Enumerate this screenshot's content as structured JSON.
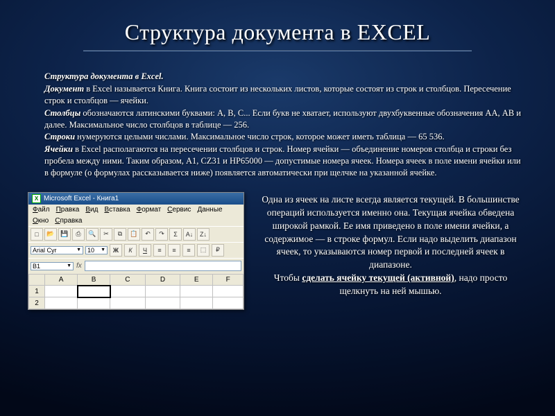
{
  "title": "Структура документа в EXCEL",
  "intro": {
    "heading": "Структура документа в Excel.",
    "p1a": "Документ",
    "p1b": " в Excel называется Книга. Книга состоит из нескольких листов, которые состоят из строк и столбцов. Пересечение строк и столбцов — ячейки.",
    "p2a": "Столбцы",
    "p2b": " обозначаются латинскими буквами: А, В, С... Если букв не хватает, используют двухбуквенные обозначения АА, АВ и далее. Максимальное число столбцов в таблице — 256.",
    "p3a": "Строки",
    "p3b": " нумеруются целыми числами. Максимальное число строк, которое может иметь таблица — 65 536.",
    "p4a": "Ячейки",
    "p4b": " в Excel располагаются на пересечении столбцов и строк. Номер ячейки — объединение номеров столбца и строки без пробела между ними. Таким образом, А1, CZ31 и НР65000 — допустимые номера ячеек. Номера ячеек в поле имени ячейки или в формуле (о формулах рассказывается ниже) появляется автоматически при щелчке на указанной ячейке."
  },
  "excel": {
    "title": "Microsoft Excel - Книга1",
    "menus": [
      "Файл",
      "Правка",
      "Вид",
      "Вставка",
      "Формат",
      "Сервис",
      "Данные",
      "Окно",
      "Справка"
    ],
    "font": "Arial Cyr",
    "fontsize": "10",
    "namebox": "B1",
    "cols": [
      "A",
      "B",
      "C",
      "D",
      "E",
      "F"
    ],
    "rows": [
      "1",
      "2"
    ]
  },
  "aside": {
    "p1": "Одна из ячеек на листе всегда является текущей. В большинстве операций используется именно она. Текущая ячейка обведена широкой рамкой. Ее имя приведено в поле имени ячейки, а содержимое — в строке формул. Если надо выделить диапазон ячеек, то указываются номер первой и последней ячеек в диапазоне.",
    "p2a": "Чтобы ",
    "p2b": "сделать ячейку текущей (активной)",
    "p2c": ", надо просто щелкнуть на ней мышью."
  }
}
